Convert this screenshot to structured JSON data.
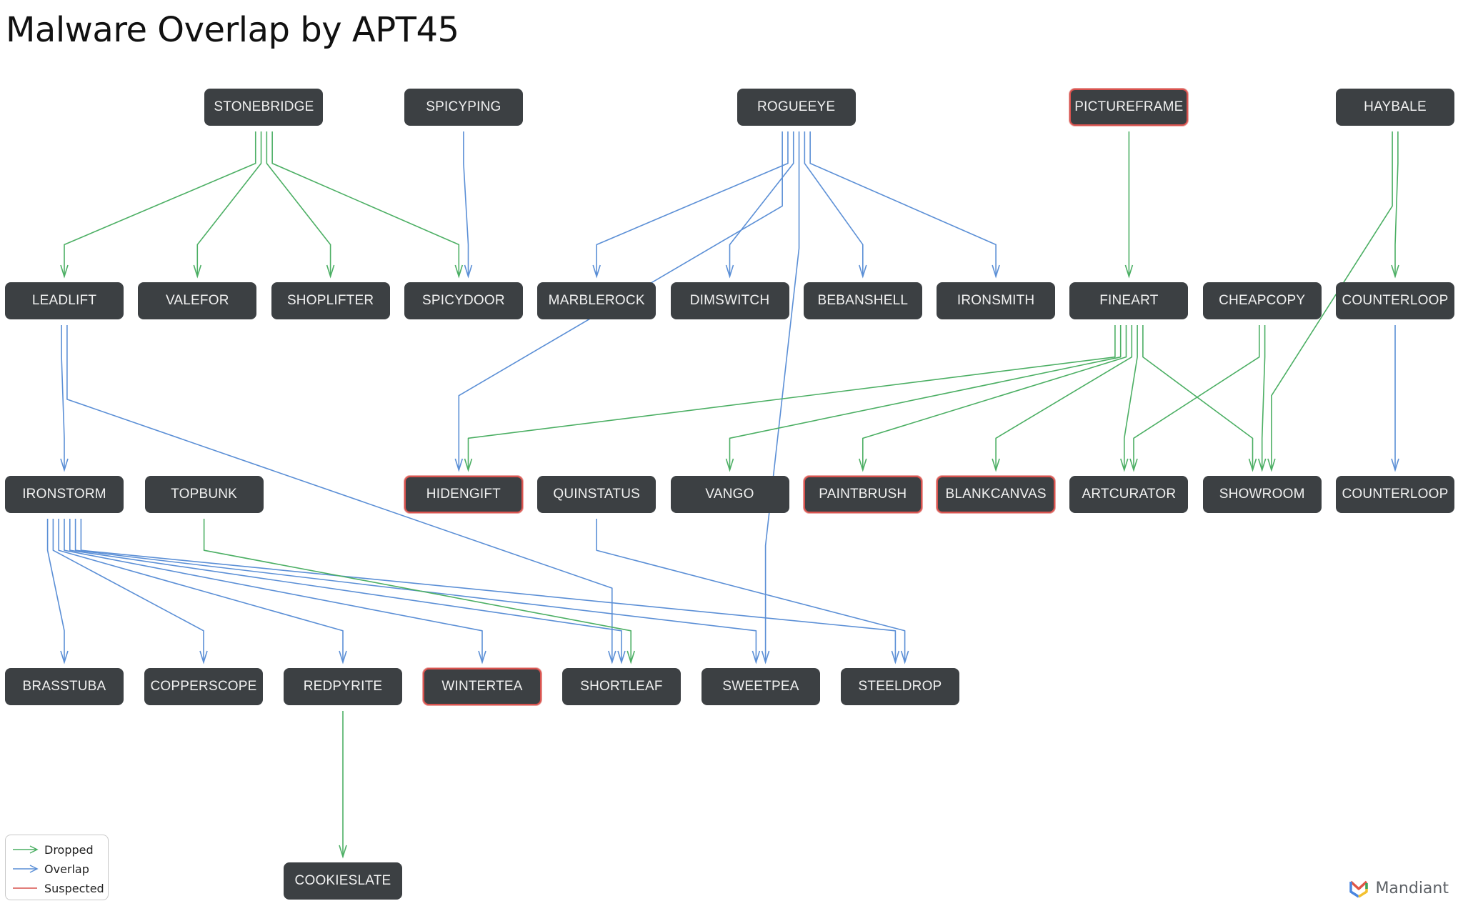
{
  "title": "Malware Overlap by APT45",
  "colors": {
    "dropped": "#4caf64",
    "overlap": "#5b8fd6",
    "suspected": "#d9534f",
    "node_bg": "#3c4043"
  },
  "legend": [
    {
      "type": "dropped",
      "label": "Dropped"
    },
    {
      "type": "overlap",
      "label": "Overlap"
    },
    {
      "type": "suspected",
      "label": "Suspected"
    }
  ],
  "brand": "Mandiant",
  "nodes": [
    {
      "id": "STONEBRIDGE",
      "label": "STONEBRIDGE",
      "row": 0,
      "col": 1.5,
      "suspected": false
    },
    {
      "id": "SPICYPING",
      "label": "SPICYPING",
      "row": 0,
      "col": 3,
      "suspected": false
    },
    {
      "id": "ROGUEEYE",
      "label": "ROGUEEYE",
      "row": 0,
      "col": 5.5,
      "suspected": false
    },
    {
      "id": "PICTUREFRAME",
      "label": "PICTUREFRAME",
      "row": 0,
      "col": 8,
      "suspected": true
    },
    {
      "id": "HAYBALE",
      "label": "HAYBALE",
      "row": 0,
      "col": 10,
      "suspected": false
    },
    {
      "id": "LEADLIFT",
      "label": "LEADLIFT",
      "row": 1,
      "col": 0,
      "suspected": false
    },
    {
      "id": "VALEFOR",
      "label": "VALEFOR",
      "row": 1,
      "col": 1,
      "suspected": false
    },
    {
      "id": "SHOPLIFTER",
      "label": "SHOPLIFTER",
      "row": 1,
      "col": 2,
      "suspected": false
    },
    {
      "id": "SPICYDOOR",
      "label": "SPICYDOOR",
      "row": 1,
      "col": 3,
      "suspected": false
    },
    {
      "id": "MARBLEROCK",
      "label": "MARBLEROCK",
      "row": 1,
      "col": 4,
      "suspected": false
    },
    {
      "id": "DIMSWITCH",
      "label": "DIMSWITCH",
      "row": 1,
      "col": 5,
      "suspected": false
    },
    {
      "id": "BEBANSHELL",
      "label": "BEBANSHELL",
      "row": 1,
      "col": 6,
      "suspected": false
    },
    {
      "id": "IRONSMITH",
      "label": "IRONSMITH",
      "row": 1,
      "col": 7,
      "suspected": false
    },
    {
      "id": "FINEART",
      "label": "FINEART",
      "row": 1,
      "col": 8,
      "suspected": false
    },
    {
      "id": "CHEAPCOPY",
      "label": "CHEAPCOPY",
      "row": 1,
      "col": 9,
      "suspected": false
    },
    {
      "id": "COUNTERLOOP_A",
      "label": "COUNTERLOOP",
      "row": 1,
      "col": 10,
      "suspected": false
    },
    {
      "id": "IRONSTORM",
      "label": "IRONSTORM",
      "row": 2,
      "col": 0,
      "suspected": false
    },
    {
      "id": "TOPBUNK",
      "label": "TOPBUNK",
      "row": 2,
      "col": 1.05,
      "suspected": false
    },
    {
      "id": "HIDENGIFT",
      "label": "HIDENGIFT",
      "row": 2,
      "col": 3,
      "suspected": true
    },
    {
      "id": "QUINSTATUS",
      "label": "QUINSTATUS",
      "row": 2,
      "col": 4,
      "suspected": false
    },
    {
      "id": "VANGO",
      "label": "VANGO",
      "row": 2,
      "col": 5,
      "suspected": false
    },
    {
      "id": "PAINTBRUSH",
      "label": "PAINTBRUSH",
      "row": 2,
      "col": 6,
      "suspected": true
    },
    {
      "id": "BLANKCANVAS",
      "label": "BLANKCANVAS",
      "row": 2,
      "col": 7,
      "suspected": true
    },
    {
      "id": "ARTCURATOR",
      "label": "ARTCURATOR",
      "row": 2,
      "col": 8,
      "suspected": false
    },
    {
      "id": "SHOWROOM",
      "label": "SHOWROOM",
      "row": 2,
      "col": 9,
      "suspected": false
    },
    {
      "id": "COUNTERLOOP_B",
      "label": "COUNTERLOOP",
      "row": 2,
      "col": 10,
      "suspected": false
    },
    {
      "id": "BRASSTUBA",
      "label": "BRASSTUBA",
      "row": 3,
      "col": 0,
      "suspected": false,
      "wide": true
    },
    {
      "id": "COPPERSCOPE",
      "label": "COPPERSCOPE",
      "row": 3,
      "col": 1,
      "suspected": false,
      "wide": true
    },
    {
      "id": "REDPYRITE",
      "label": "REDPYRITE",
      "row": 3,
      "col": 2,
      "suspected": false,
      "wide": true
    },
    {
      "id": "WINTERTEA",
      "label": "WINTERTEA",
      "row": 3,
      "col": 3,
      "suspected": true,
      "wide": true
    },
    {
      "id": "SHORTLEAF",
      "label": "SHORTLEAF",
      "row": 3,
      "col": 4,
      "suspected": false,
      "wide": true
    },
    {
      "id": "SWEETPEA",
      "label": "SWEETPEA",
      "row": 3,
      "col": 5,
      "suspected": false,
      "wide": true
    },
    {
      "id": "STEELDROP",
      "label": "STEELDROP",
      "row": 3,
      "col": 6,
      "suspected": false,
      "wide": true
    },
    {
      "id": "COOKIESLATE",
      "label": "COOKIESLATE",
      "row": 4,
      "col": 2,
      "suspected": false,
      "wide": true
    }
  ],
  "edges": [
    {
      "from": "STONEBRIDGE",
      "to": "LEADLIFT",
      "type": "dropped"
    },
    {
      "from": "STONEBRIDGE",
      "to": "VALEFOR",
      "type": "dropped"
    },
    {
      "from": "STONEBRIDGE",
      "to": "SHOPLIFTER",
      "type": "dropped"
    },
    {
      "from": "STONEBRIDGE",
      "to": "SPICYDOOR",
      "type": "dropped"
    },
    {
      "from": "SPICYPING",
      "to": "SPICYDOOR",
      "type": "overlap"
    },
    {
      "from": "ROGUEEYE",
      "to": "MARBLEROCK",
      "type": "overlap"
    },
    {
      "from": "ROGUEEYE",
      "to": "DIMSWITCH",
      "type": "overlap"
    },
    {
      "from": "ROGUEEYE",
      "to": "HIDENGIFT",
      "type": "overlap"
    },
    {
      "from": "ROGUEEYE",
      "to": "SWEETPEA",
      "type": "overlap"
    },
    {
      "from": "ROGUEEYE",
      "to": "BEBANSHELL",
      "type": "overlap"
    },
    {
      "from": "ROGUEEYE",
      "to": "IRONSMITH",
      "type": "overlap"
    },
    {
      "from": "PICTUREFRAME",
      "to": "FINEART",
      "type": "dropped"
    },
    {
      "from": "HAYBALE",
      "to": "SHOWROOM",
      "type": "dropped"
    },
    {
      "from": "HAYBALE",
      "to": "COUNTERLOOP_A",
      "type": "dropped"
    },
    {
      "from": "LEADLIFT",
      "to": "IRONSTORM",
      "type": "overlap"
    },
    {
      "from": "LEADLIFT",
      "to": "SHORTLEAF",
      "type": "overlap"
    },
    {
      "from": "FINEART",
      "to": "HIDENGIFT",
      "type": "dropped"
    },
    {
      "from": "FINEART",
      "to": "VANGO",
      "type": "dropped"
    },
    {
      "from": "FINEART",
      "to": "PAINTBRUSH",
      "type": "dropped"
    },
    {
      "from": "FINEART",
      "to": "BLANKCANVAS",
      "type": "dropped"
    },
    {
      "from": "FINEART",
      "to": "ARTCURATOR",
      "type": "dropped"
    },
    {
      "from": "FINEART",
      "to": "SHOWROOM",
      "type": "dropped"
    },
    {
      "from": "CHEAPCOPY",
      "to": "ARTCURATOR",
      "type": "dropped"
    },
    {
      "from": "CHEAPCOPY",
      "to": "SHOWROOM",
      "type": "dropped"
    },
    {
      "from": "COUNTERLOOP_A",
      "to": "COUNTERLOOP_B",
      "type": "overlap"
    },
    {
      "from": "IRONSTORM",
      "to": "BRASSTUBA",
      "type": "overlap"
    },
    {
      "from": "IRONSTORM",
      "to": "COPPERSCOPE",
      "type": "overlap"
    },
    {
      "from": "IRONSTORM",
      "to": "REDPYRITE",
      "type": "overlap"
    },
    {
      "from": "IRONSTORM",
      "to": "WINTERTEA",
      "type": "overlap"
    },
    {
      "from": "IRONSTORM",
      "to": "SHORTLEAF",
      "type": "overlap"
    },
    {
      "from": "IRONSTORM",
      "to": "SWEETPEA",
      "type": "overlap"
    },
    {
      "from": "IRONSTORM",
      "to": "STEELDROP",
      "type": "overlap"
    },
    {
      "from": "TOPBUNK",
      "to": "SHORTLEAF",
      "type": "dropped"
    },
    {
      "from": "QUINSTATUS",
      "to": "STEELDROP",
      "type": "overlap"
    },
    {
      "from": "REDPYRITE",
      "to": "COOKIESLATE",
      "type": "dropped"
    }
  ]
}
